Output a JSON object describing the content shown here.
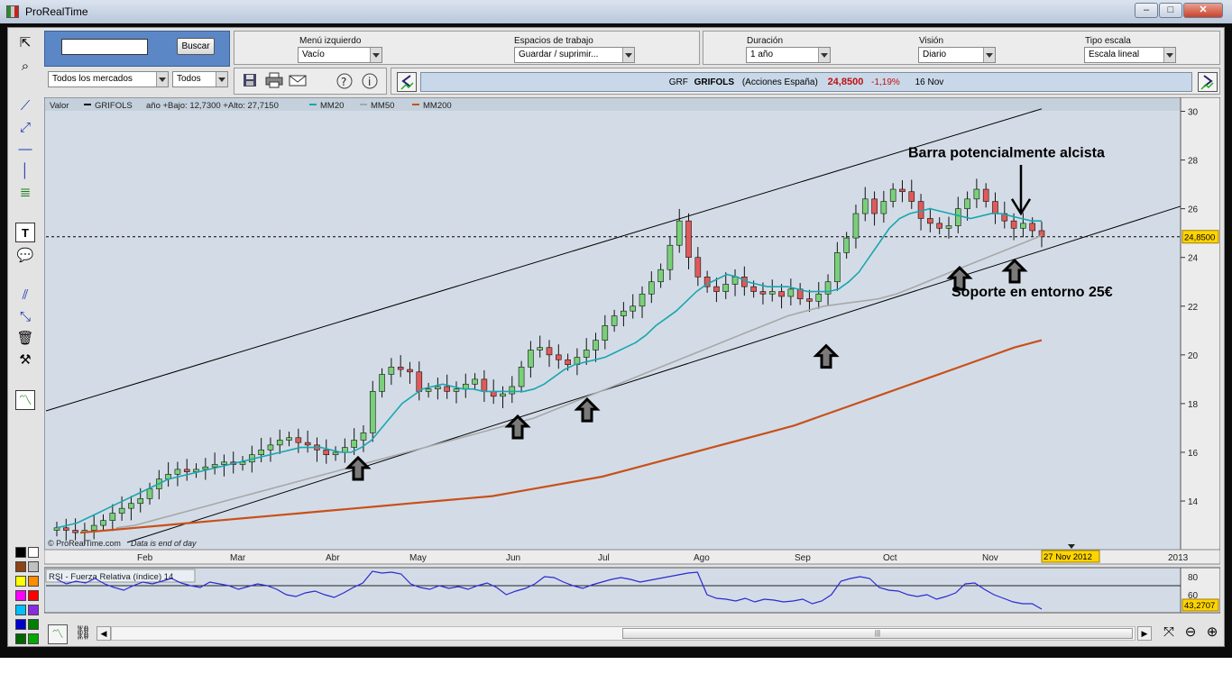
{
  "window": {
    "title": "ProRealTime",
    "min": "–",
    "max": "□",
    "close": "✕"
  },
  "search": {
    "value": "",
    "button": "Buscar",
    "market": "Todos los mercados",
    "filter": "Todos"
  },
  "menus": {
    "left_menu_label": "Menú izquierdo",
    "left_menu_value": "Vacío",
    "workspace_label": "Espacios de trabajo",
    "workspace_value": "Guardar / suprimir...",
    "duration_label": "Duración",
    "duration_value": "1 año",
    "view_label": "Visión",
    "view_value": "Diario",
    "scale_label": "Tipo escala",
    "scale_value": "Escala lineal"
  },
  "ticker": {
    "symbol": "GRF",
    "name": "GRIFOLS",
    "market": "(Acciones España)",
    "price": "24,8500",
    "change": "-1,19%",
    "date": "16 Nov"
  },
  "legend": {
    "valor": "Valor",
    "series": "GRIFOLS",
    "range": "año +Bajo: 12,7300 +Alto: 27,7150",
    "mm20": "MM20",
    "mm50": "MM50",
    "mm200": "MM200"
  },
  "annotations": {
    "bullish": "Barra potencialmente alcista",
    "support": "Soporte en entorno 25€",
    "copyright": "© ProRealTime.com",
    "eod": "Data is end of day",
    "cursor_date": "27 Nov 2012"
  },
  "colors": {
    "mm20": "#1aa6b0",
    "mm50": "#a8a8a8",
    "mm200": "#c8501a",
    "rsi": "#2a2ad0",
    "up": "#7ad07a",
    "down": "#e05a5a",
    "bg": "#d3dce6"
  },
  "chart_data": {
    "type": "candlestick",
    "title": "GRF GRIFOLS (Acciones España)",
    "last_price": 24.85,
    "last_price_label": "24,8500",
    "ylim": [
      12.3,
      30.5
    ],
    "y_ticks": [
      14,
      16,
      18,
      20,
      22,
      24,
      26,
      28,
      30
    ],
    "x_ticks": [
      "Feb",
      "Mar",
      "Abr",
      "May",
      "Jun",
      "Jul",
      "Ago",
      "Sep",
      "Oct",
      "Nov",
      "2013"
    ],
    "close_series": [
      12.9,
      12.8,
      12.7,
      12.8,
      13.0,
      13.2,
      13.5,
      13.7,
      13.9,
      14.1,
      14.5,
      14.9,
      15.1,
      15.3,
      15.2,
      15.3,
      15.4,
      15.5,
      15.6,
      15.5,
      15.6,
      15.9,
      16.1,
      16.3,
      16.5,
      16.6,
      16.4,
      16.3,
      16.1,
      15.9,
      16.0,
      16.2,
      16.5,
      16.8,
      18.5,
      19.2,
      19.5,
      19.4,
      19.3,
      18.5,
      18.6,
      18.7,
      18.5,
      18.6,
      18.8,
      19.0,
      18.5,
      18.3,
      18.4,
      18.7,
      19.5,
      20.2,
      20.3,
      20.0,
      19.8,
      19.6,
      19.9,
      20.2,
      20.6,
      21.2,
      21.6,
      21.8,
      22.0,
      22.5,
      23.0,
      23.5,
      24.5,
      25.5,
      24.0,
      23.2,
      22.8,
      22.6,
      22.9,
      23.2,
      22.8,
      22.6,
      22.5,
      22.6,
      22.4,
      22.7,
      22.3,
      22.2,
      22.5,
      23.0,
      24.2,
      24.8,
      25.8,
      26.4,
      25.8,
      26.3,
      26.8,
      26.7,
      26.3,
      25.6,
      25.4,
      25.2,
      25.3,
      26.0,
      26.4,
      26.8,
      26.3,
      25.8,
      25.5,
      25.2,
      25.4,
      25.1,
      24.85
    ],
    "series": [
      {
        "name": "GRIFOLS",
        "values": "close_series"
      },
      {
        "name": "MM20",
        "values": [
          12.9,
          13.0,
          13.1,
          13.3,
          13.5,
          13.7,
          13.9,
          14.1,
          14.3,
          14.5,
          14.7,
          14.9,
          15.0,
          15.1,
          15.2,
          15.3,
          15.4,
          15.5,
          15.6,
          15.7,
          15.8,
          15.9,
          16.0,
          16.1,
          16.2,
          16.2,
          16.2,
          16.1,
          16.0,
          16.0,
          16.2,
          16.5,
          17.0,
          17.5,
          18.0,
          18.3,
          18.6,
          18.7,
          18.8,
          18.7,
          18.6,
          18.6,
          18.5,
          18.5,
          18.5,
          18.5,
          18.5,
          18.6,
          18.8,
          19.1,
          19.4,
          19.6,
          19.7,
          19.8,
          19.9,
          20.1,
          20.3,
          20.5,
          20.8,
          21.2,
          21.5,
          21.8,
          22.2,
          22.6,
          22.9,
          23.1,
          23.3,
          23.2,
          23.0,
          22.9,
          22.8,
          22.8,
          22.8,
          22.7,
          22.6,
          22.6,
          22.6,
          22.7,
          23.0,
          23.4,
          24.0,
          24.6,
          25.2,
          25.6,
          25.8,
          25.9,
          26.0,
          25.9,
          25.8,
          25.7,
          25.6,
          25.7,
          25.8,
          25.8,
          25.7,
          25.6,
          25.5,
          25.5
        ]
      },
      {
        "name": "MM50",
        "values": [
          12.9,
          13.0,
          13.2,
          13.4,
          13.6,
          13.8,
          14.0,
          14.2,
          14.4,
          14.6,
          14.8,
          15.0,
          15.2,
          15.4,
          15.6,
          15.8,
          16.0,
          16.2,
          16.4,
          16.6,
          16.8,
          17.0,
          17.2,
          17.4,
          17.7,
          18.0,
          18.3,
          18.6,
          18.9,
          19.2,
          19.5,
          19.8,
          20.1,
          20.4,
          20.7,
          21.0,
          21.3,
          21.6,
          21.8,
          22.0,
          22.1,
          22.2,
          22.3,
          22.5,
          22.8,
          23.1,
          23.4,
          23.7,
          24.0,
          24.3,
          24.6,
          24.9
        ]
      },
      {
        "name": "MM200",
        "values": [
          12.7,
          12.8,
          12.9,
          13.0,
          13.1,
          13.2,
          13.3,
          13.4,
          13.5,
          13.6,
          13.7,
          13.8,
          13.9,
          14.0,
          14.1,
          14.2,
          14.4,
          14.6,
          14.8,
          15.0,
          15.3,
          15.6,
          15.9,
          16.2,
          16.5,
          16.8,
          17.1,
          17.5,
          17.9,
          18.3,
          18.7,
          19.1,
          19.5,
          19.9,
          20.3,
          20.6
        ]
      }
    ],
    "rsi": {
      "label": "RSI - Fuerza Relativa (índice) 14",
      "last": "43,2707",
      "ylim": [
        40,
        90
      ],
      "y_ticks": [
        60,
        80
      ],
      "overbought": 70,
      "values": [
        77,
        72,
        75,
        73,
        78,
        72,
        68,
        65,
        70,
        74,
        72,
        75,
        78,
        73,
        70,
        68,
        74,
        72,
        70,
        66,
        69,
        72,
        70,
        66,
        60,
        58,
        62,
        64,
        60,
        57,
        62,
        68,
        73,
        86,
        84,
        85,
        83,
        72,
        68,
        66,
        70,
        67,
        69,
        66,
        70,
        73,
        68,
        60,
        64,
        67,
        72,
        80,
        79,
        74,
        70,
        67,
        71,
        74,
        77,
        79,
        77,
        74,
        76,
        78,
        80,
        82,
        84,
        85,
        60,
        56,
        55,
        53,
        56,
        52,
        55,
        54,
        52,
        53,
        55,
        50,
        53,
        60,
        75,
        78,
        80,
        78,
        68,
        65,
        64,
        60,
        58,
        60,
        55,
        58,
        62,
        72,
        73,
        66,
        60,
        56,
        52,
        50,
        50,
        44
      ]
    }
  },
  "tools": {
    "left": [
      "cursor-icon",
      "zoom-icon",
      "line-icon",
      "ray-icon",
      "hline-icon",
      "vline-icon",
      "fibo-icon",
      "text-icon",
      "comment-icon",
      "channel-icon",
      "regression-icon",
      "trash-icon",
      "hammer-icon",
      "indicator-icon"
    ],
    "palette": [
      "#000000",
      "#ffffff",
      "#8b4513",
      "#c0c0c0",
      "#ffff00",
      "#ff8c00",
      "#ff00ff",
      "#ff0000",
      "#00bfff",
      "#8a2be2",
      "#0000cd",
      "#008000",
      "#006400",
      "#00aa00"
    ]
  }
}
